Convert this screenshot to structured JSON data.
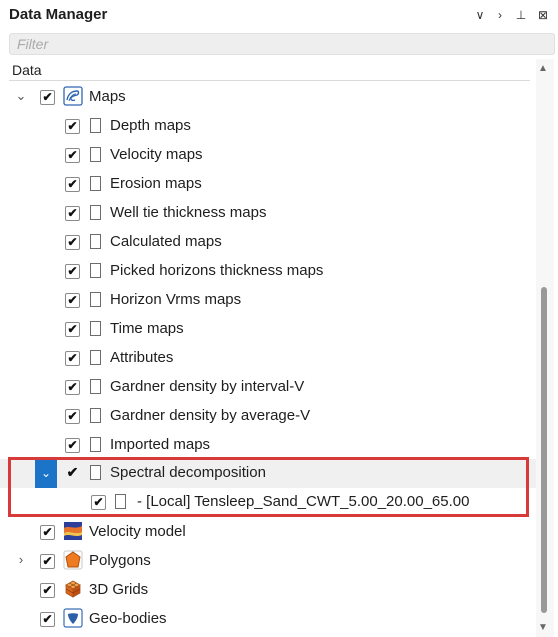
{
  "panel": {
    "title": "Data Manager",
    "buttons": {
      "collapse": "∨",
      "expand": "›",
      "pin": "⊥",
      "close": "⊠"
    }
  },
  "filter": {
    "placeholder": "Filter",
    "value": ""
  },
  "tree": {
    "column_header": "Data",
    "maps": {
      "label": "Maps",
      "checked": true,
      "icon": "maps-icon",
      "children": [
        {
          "label": "Depth maps",
          "checked": true
        },
        {
          "label": "Velocity maps",
          "checked": true
        },
        {
          "label": "Erosion maps",
          "checked": true
        },
        {
          "label": "Well tie thickness maps",
          "checked": true
        },
        {
          "label": "Calculated maps",
          "checked": true
        },
        {
          "label": "Picked horizons thickness maps",
          "checked": true
        },
        {
          "label": "Horizon Vrms maps",
          "checked": true
        },
        {
          "label": "Time maps",
          "checked": true
        },
        {
          "label": "Attributes",
          "checked": true
        },
        {
          "label": "Gardner density by interval-V",
          "checked": true
        },
        {
          "label": "Gardner density by average-V",
          "checked": true
        },
        {
          "label": "Imported maps",
          "checked": true
        }
      ],
      "spectral": {
        "label": "Spectral decomposition",
        "checked": true,
        "child": {
          "label": "- [Local] Tensleep_Sand_CWT_5.00_20.00_65.00",
          "checked": true
        }
      }
    },
    "others": [
      {
        "label": "Velocity model",
        "checked": true,
        "icon": "velocity-model-icon"
      },
      {
        "label": "Polygons",
        "checked": true,
        "icon": "polygons-icon"
      },
      {
        "label": "3D Grids",
        "checked": true,
        "icon": "3d-grids-icon"
      },
      {
        "label": "Geo-bodies",
        "checked": true,
        "icon": "geo-bodies-icon"
      }
    ]
  },
  "glyphs": {
    "check": "✔",
    "expanded": "⌄",
    "collapsed": "›",
    "scroll_up": "▲",
    "scroll_down": "▼"
  },
  "colors": {
    "selection": "#1c74c8",
    "highlight_box": "#d83a3a"
  }
}
